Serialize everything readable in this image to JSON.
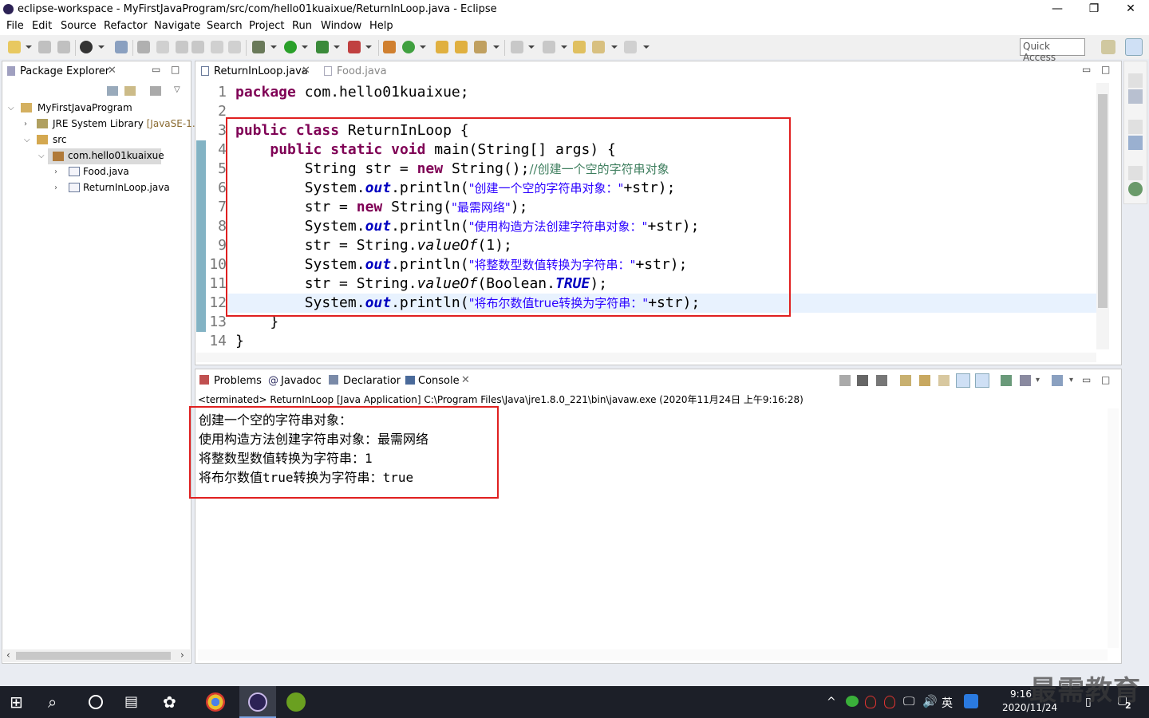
{
  "window": {
    "title": "eclipse-workspace - MyFirstJavaProgram/src/com/hello01kuaixue/ReturnInLoop.java - Eclipse",
    "minimize": "—",
    "restore": "❐",
    "close": "✕"
  },
  "menu": [
    "File",
    "Edit",
    "Source",
    "Refactor",
    "Navigate",
    "Search",
    "Project",
    "Run",
    "Window",
    "Help"
  ],
  "quick_access": "Quick Access",
  "package_explorer": {
    "title": "Package Explorer",
    "tree": [
      {
        "label": "MyFirstJavaProgram",
        "icon": "project-icon"
      },
      {
        "label": "JRE System Library",
        "suffix": "[JavaSE-1.",
        "icon": "library-icon"
      },
      {
        "label": "src",
        "icon": "folder-icon"
      },
      {
        "label": "com.hello01kuaixue",
        "icon": "package-icon"
      },
      {
        "label": "Food.java",
        "icon": "java-file-icon"
      },
      {
        "label": "ReturnInLoop.java",
        "icon": "java-file-icon"
      }
    ]
  },
  "editor": {
    "tabs": [
      {
        "label": "ReturnInLoop.java",
        "active": true
      },
      {
        "label": "Food.java",
        "active": false
      }
    ],
    "line_numbers": [
      "1",
      "2",
      "3",
      "4",
      "5",
      "6",
      "7",
      "8",
      "9",
      "10",
      "11",
      "12",
      "13",
      "14"
    ],
    "code": {
      "l1_kw": "package",
      "l1_rest": " com.hello01kuaixue;",
      "l3_kw1": "public",
      "l3_kw2": "class",
      "l3_rest": " ReturnInLoop {",
      "l4_kw1": "public",
      "l4_kw2": "static",
      "l4_kw3": "void",
      "l4_rest": " main(String[] args) {",
      "l5_a": "String str = ",
      "l5_kw": "new",
      "l5_b": " String();",
      "l5_cm": "//创建一个空的字符串对象",
      "l6_a": "System.",
      "l6_fld": "out",
      "l6_b": ".println(",
      "l6_str": "\"创建一个空的字符串对象：\"",
      "l6_c": "+str);",
      "l7_a": "str = ",
      "l7_kw": "new",
      "l7_b": " String(",
      "l7_str": "\"最需网络\"",
      "l7_c": ");",
      "l8_a": "System.",
      "l8_fld": "out",
      "l8_b": ".println(",
      "l8_str": "\"使用构造方法创建字符串对象：\"",
      "l8_c": "+str);",
      "l9_a": "str = String.",
      "l9_it": "valueOf",
      "l9_b": "(1);",
      "l10_a": "System.",
      "l10_fld": "out",
      "l10_b": ".println(",
      "l10_str": "\"将整数型数值转换为字符串：\"",
      "l10_c": "+str);",
      "l11_a": "str = String.",
      "l11_it": "valueOf",
      "l11_b": "(Boolean.",
      "l11_fld": "TRUE",
      "l11_c": ");",
      "l12_a": "System.",
      "l12_fld": "out",
      "l12_b": ".println(",
      "l12_str": "\"将布尔数值true转换为字符串：\"",
      "l12_c": "+str);",
      "l13": "}",
      "l14": "}"
    }
  },
  "bottom_tabs": [
    "Problems",
    "Javadoc",
    "Declaration",
    "Console"
  ],
  "console": {
    "status": "<terminated> ReturnInLoop [Java Application] C:\\Program Files\\Java\\jre1.8.0_221\\bin\\javaw.exe (2020年11月24日 上午9:16:28)",
    "lines": [
      {
        "a": "创建一个空的字符串对象：",
        "b": ""
      },
      {
        "a": "使用构造方法创建字符串对象：最需网络",
        "b": ""
      },
      {
        "a": "将整数型数值转换为字符串：",
        "b": "1"
      },
      {
        "a": "将布尔数值",
        "b": "true",
        "c": "转换为字符串：",
        "d": "true"
      }
    ]
  },
  "taskbar": {
    "ime": "英",
    "time": "9:16",
    "date": "2020/11/24",
    "notif_count": "2"
  },
  "watermark": "最需教育"
}
